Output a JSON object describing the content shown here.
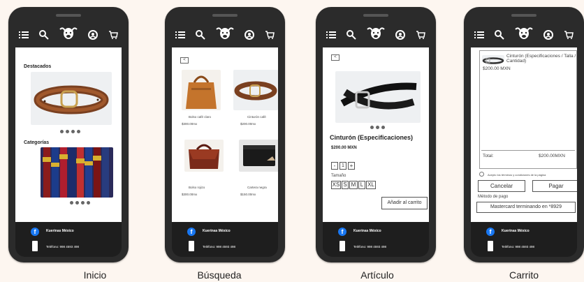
{
  "screens": {
    "inicio": {
      "caption": "Inicio",
      "destacados": "Destacados",
      "categorias": "Categorías"
    },
    "busqueda": {
      "caption": "Búsqueda",
      "back": "<",
      "products": [
        {
          "name": "Bolso café claro",
          "price": "$300.00mx"
        },
        {
          "name": "Cinturón café",
          "price": "$200.00mx"
        },
        {
          "name": "Bolso rojizo",
          "price": "$300.00mx"
        },
        {
          "name": "Cartera negra",
          "price": "$150.00mx"
        }
      ]
    },
    "articulo": {
      "caption": "Artículo",
      "back": "<",
      "title": "Cinturón (Especificaciones)",
      "price": "$200.00 MXN",
      "minus": "-",
      "qty": "1",
      "plus": "+",
      "size_label": "Tamaño",
      "sizes": [
        "XS",
        "S",
        "M",
        "L",
        "XL"
      ],
      "add_to_cart": "Añadir al carrito"
    },
    "carrito": {
      "caption": "Carrito",
      "item_title": "Cinturón (Especificaciones / Talla / Cantidad)",
      "item_price": "$200.00 MXN",
      "total_label": "Total:",
      "total_value": "$200.00MXN",
      "terms": "Acepto los términos y condiciones de la página",
      "cancel": "Cancelar",
      "pay": "Pagar",
      "payment_label": "Método de pago",
      "payment_value": "Mastercard terminando en *8929"
    }
  },
  "footer": {
    "brand": "Kuerinas México",
    "phone": "Teléfono: 998 4593 498"
  },
  "icons": {
    "menu": "menu-icon",
    "search": "search-icon",
    "logo": "bull-logo-icon",
    "account": "account-icon",
    "cart": "cart-icon"
  }
}
